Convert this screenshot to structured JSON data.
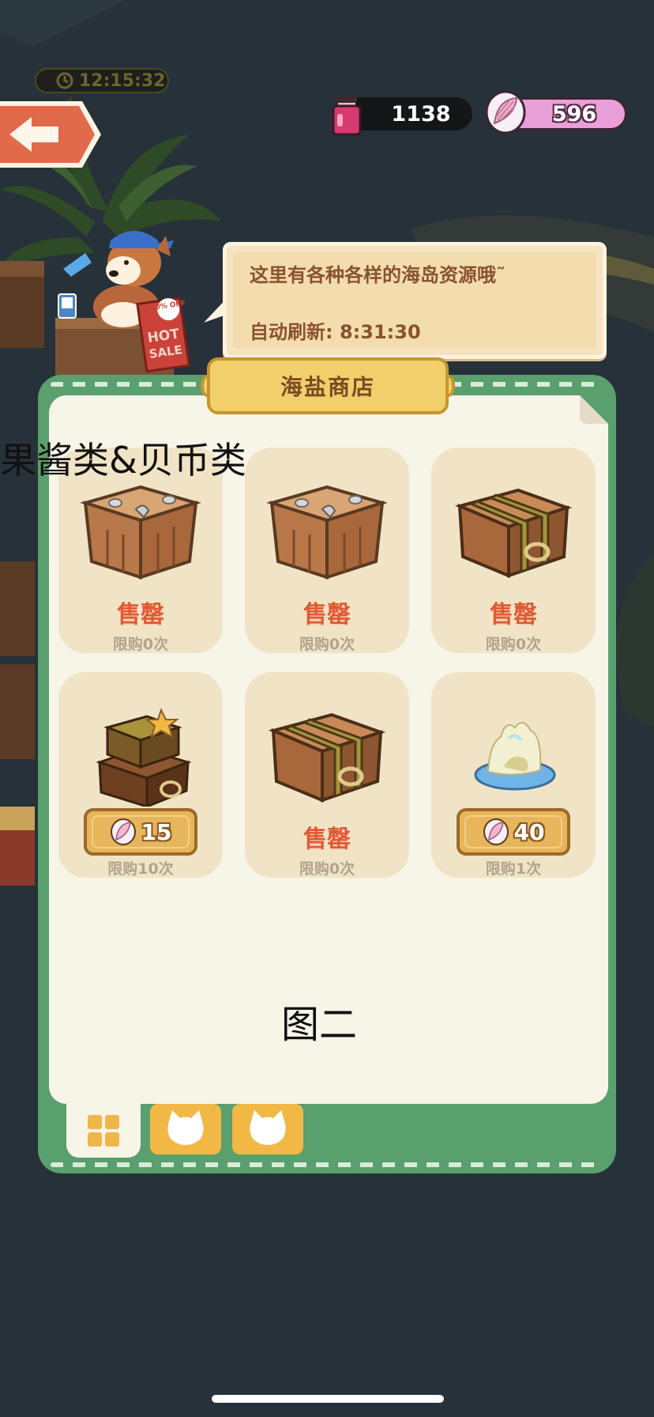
{
  "status": {
    "clock": "12:15:32"
  },
  "resources": {
    "jam": {
      "value": "1138",
      "icon": "jam-jar-icon",
      "color": "#d63a6e"
    },
    "shell_coin": {
      "value": "596",
      "icon": "shell-coin-icon",
      "color": "#e9a0d8"
    }
  },
  "speech": {
    "line1": "这里有各种各样的海岛资源哦˜",
    "line2": "自动刷新: 8:31:30"
  },
  "merchant_sign": {
    "top": "50% OFF",
    "hot": "HOT",
    "sale": "SALE"
  },
  "shop": {
    "title": "海盐商店",
    "overlay_caption": "果酱类&贝币类",
    "figure_label": "图二",
    "items": [
      {
        "art": "wooden-crate-icon",
        "state": "售罄",
        "limit": "限购0次"
      },
      {
        "art": "wooden-crate-icon",
        "state": "售罄",
        "limit": "限购0次"
      },
      {
        "art": "strapped-chest-icon",
        "state": "售罄",
        "limit": "限购0次"
      },
      {
        "art": "treasure-chest-stack-icon",
        "price": "15",
        "price_icon": "shell-coin-icon",
        "limit": "限购10次"
      },
      {
        "art": "strapped-chest-icon",
        "state": "售罄",
        "limit": "限购0次"
      },
      {
        "art": "sea-salt-icon",
        "price": "40",
        "price_icon": "shell-coin-icon",
        "limit": "限购1次"
      }
    ]
  },
  "tabs": [
    {
      "icon": "grid-icon",
      "selected": true
    },
    {
      "icon": "cat-icon",
      "selected": false
    },
    {
      "icon": "cat-icon",
      "selected": false
    }
  ],
  "colors": {
    "panel_green": "#5a9f6e",
    "sold_out_red": "#e05a34",
    "plaque_gold": "#f1cf6a"
  }
}
